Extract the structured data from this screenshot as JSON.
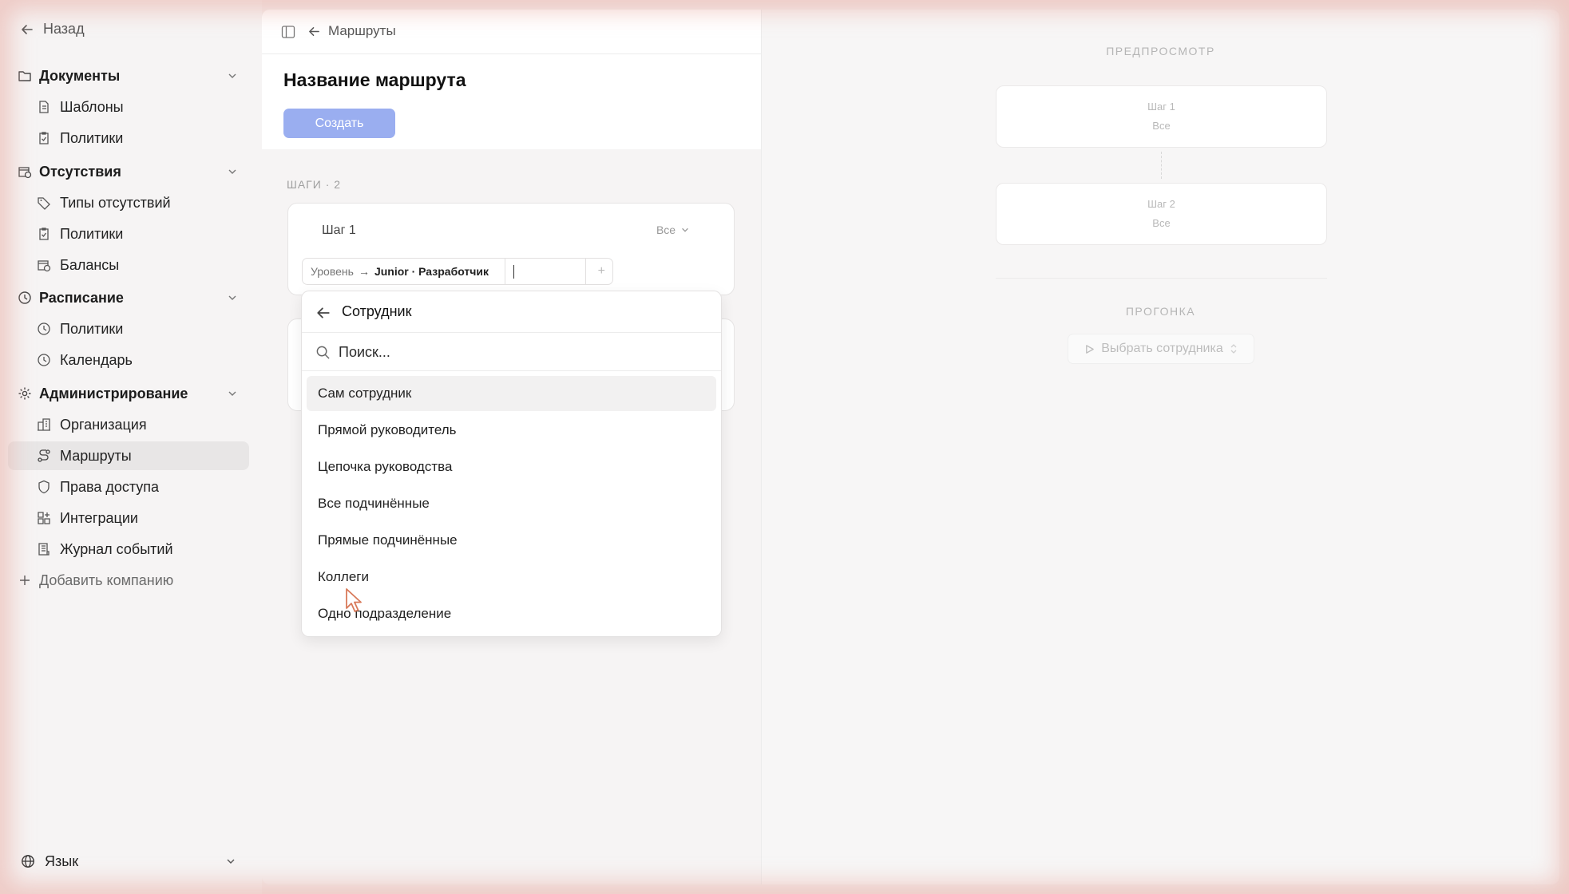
{
  "sidebar": {
    "back_label": "Назад",
    "groups": [
      {
        "label": "Документы",
        "items": [
          {
            "label": "Шаблоны"
          },
          {
            "label": "Политики"
          }
        ]
      },
      {
        "label": "Отсутствия",
        "items": [
          {
            "label": "Типы отсутствий"
          },
          {
            "label": "Политики"
          },
          {
            "label": "Балансы"
          }
        ]
      },
      {
        "label": "Расписание",
        "items": [
          {
            "label": "Политики"
          },
          {
            "label": "Календарь"
          }
        ]
      },
      {
        "label": "Администрирование",
        "items": [
          {
            "label": "Организация"
          },
          {
            "label": "Маршруты"
          },
          {
            "label": "Права доступа"
          },
          {
            "label": "Интеграции"
          },
          {
            "label": "Журнал событий"
          }
        ]
      }
    ],
    "add_company_label": "Добавить компанию",
    "language_label": "Язык",
    "active_item": "Маршруты"
  },
  "header": {
    "breadcrumb": "Маршруты"
  },
  "editor": {
    "title": "Название маршрута",
    "create_label": "Создать",
    "steps_label": "ШАГИ · 2",
    "steps": [
      {
        "title": "Шаг 1",
        "select_value": "Все",
        "condition": {
          "key": "Уровень",
          "value": "Junior · Разработчик"
        }
      }
    ]
  },
  "dropdown": {
    "title": "Сотрудник",
    "search_placeholder": "Поиск...",
    "options": [
      "Сам сотрудник",
      "Прямой руководитель",
      "Цепочка руководства",
      "Все подчинённые",
      "Прямые подчинённые",
      "Коллеги",
      "Одно подразделение"
    ],
    "highlighted_index": 0
  },
  "preview": {
    "section_label": "ПРЕДПРОСМОТР",
    "cards": [
      {
        "title": "Шаг 1",
        "subtitle": "Все"
      },
      {
        "title": "Шаг 2",
        "subtitle": "Все"
      }
    ],
    "run_section_label": "ПРОГОНКА",
    "run_button_label": "Выбрать сотрудника"
  },
  "colors": {
    "accent_button": "#9aaef0",
    "active_nav_bg": "#e8e6e6",
    "frame_glow": "#e8aaa0"
  }
}
